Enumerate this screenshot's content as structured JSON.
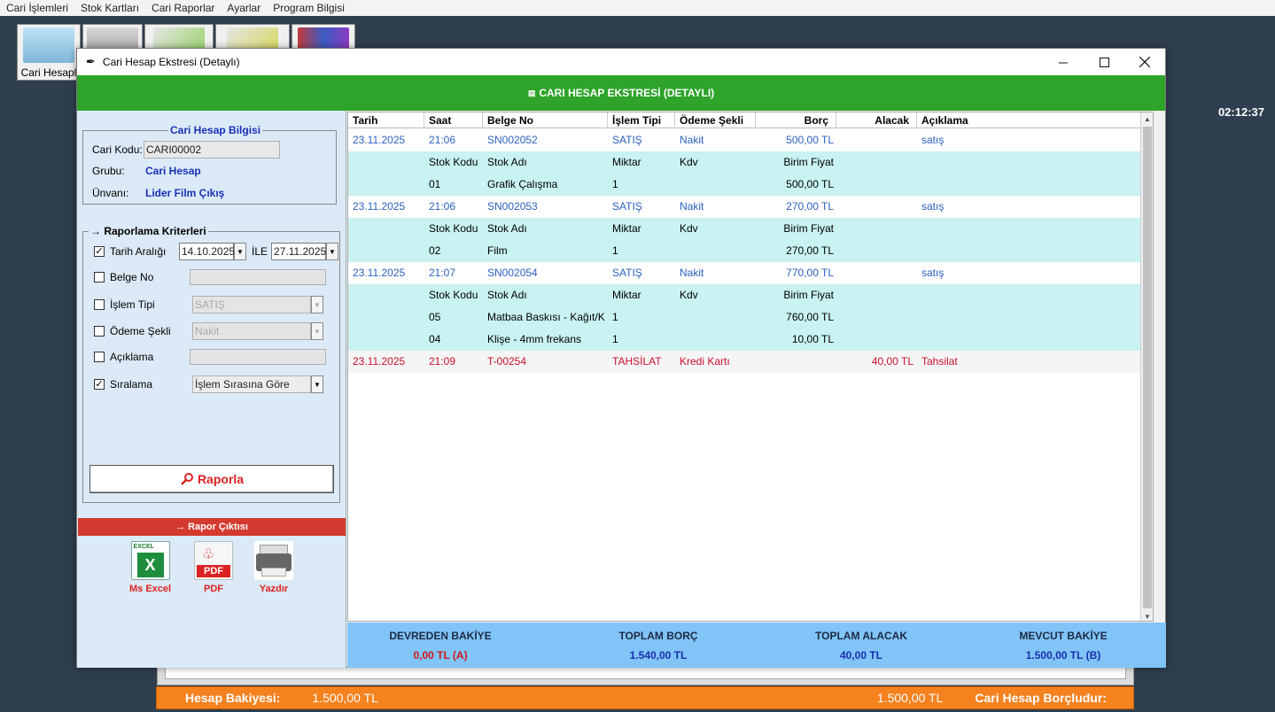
{
  "menubar": [
    "Cari İşlemleri",
    "Stok Kartları",
    "Cari Raporlar",
    "Ayarlar",
    "Program Bilgisi"
  ],
  "toolbar": {
    "first_label": "Cari Hesapl"
  },
  "clock": "02:12:37",
  "status_bar": {
    "label": "Hesap Bakiyesi:",
    "value_left": "1.500,00 TL",
    "value_right": "1.500,00 TL",
    "state": "Cari Hesap Borçludur:"
  },
  "window": {
    "title": "Cari Hesap Ekstresi (Detaylı)",
    "header": "CARI HESAP EKSTRESİ (DETAYLI)"
  },
  "account_info": {
    "title": "Cari Hesap Bilgisi",
    "code_label": "Cari Kodu:",
    "code_value": "CARI00002",
    "group_label": "Grubu:",
    "group_value": "Cari Hesap",
    "name_label": "Ünvanı:",
    "name_value": "Lider Film Çıkış"
  },
  "criteria": {
    "title": "Raporlama Kriterleri",
    "date_range_label": "Tarih Aralığı",
    "date_from": "14.10.2025",
    "date_sep": "İLE",
    "date_to": "27.11.2025",
    "doc_no_label": "Belge No",
    "tx_type_label": "İşlem Tipi",
    "tx_type_value": "SATIŞ",
    "payment_label": "Ödeme Şekli",
    "payment_value": "Nakit",
    "desc_label": "Açıklama",
    "sort_label": "Sıralama",
    "sort_value": "İşlem Sırasına Göre",
    "report_button": "Raporla"
  },
  "output": {
    "title": "Rapor Çıktısı",
    "excel": "Ms Excel",
    "pdf": "PDF",
    "print": "Yazdır",
    "excel_icon_text": "EXCEL",
    "pdf_icon_text": "PDF"
  },
  "grid": {
    "headers": [
      "Tarih",
      "Saat",
      "Belge No",
      "İşlem Tipi",
      "Ödeme Şekli",
      "Borç",
      "Alacak",
      "Açıklama"
    ],
    "rows": [
      {
        "kind": "sale",
        "cells": [
          "23.11.2025",
          "21:06",
          "SN002052",
          "SATIŞ",
          "Nakit",
          "500,00 TL",
          "",
          "satış"
        ]
      },
      {
        "kind": "detail-head",
        "cells": [
          "",
          "Stok Kodu",
          "Stok Adı",
          "Miktar",
          "Kdv",
          "Birim Fiyat",
          "",
          ""
        ]
      },
      {
        "kind": "detail",
        "cells": [
          "",
          "01",
          "Grafik Çalışma",
          "1",
          "",
          "500,00 TL",
          "",
          ""
        ]
      },
      {
        "kind": "sale",
        "cells": [
          "23.11.2025",
          "21:06",
          "SN002053",
          "SATIŞ",
          "Nakit",
          "270,00 TL",
          "",
          "satış"
        ]
      },
      {
        "kind": "detail-head",
        "cells": [
          "",
          "Stok Kodu",
          "Stok Adı",
          "Miktar",
          "Kdv",
          "Birim Fiyat",
          "",
          ""
        ]
      },
      {
        "kind": "detail",
        "cells": [
          "",
          "02",
          "Film",
          "1",
          "",
          "270,00 TL",
          "",
          ""
        ]
      },
      {
        "kind": "sale",
        "cells": [
          "23.11.2025",
          "21:07",
          "SN002054",
          "SATIŞ",
          "Nakit",
          "770,00 TL",
          "",
          "satış"
        ]
      },
      {
        "kind": "detail-head",
        "cells": [
          "",
          "Stok Kodu",
          "Stok Adı",
          "Miktar",
          "Kdv",
          "Birim Fiyat",
          "",
          ""
        ]
      },
      {
        "kind": "detail",
        "cells": [
          "",
          "05",
          "Matbaa Baskısı - Kağıt/K",
          "1",
          "",
          "760,00 TL",
          "",
          ""
        ]
      },
      {
        "kind": "detail",
        "cells": [
          "",
          "04",
          "Klişe - 4mm frekans",
          "1",
          "",
          "10,00 TL",
          "",
          ""
        ]
      },
      {
        "kind": "collection",
        "cells": [
          "23.11.2025",
          "21:09",
          "T-00254",
          "TAHSİLAT",
          "Kredi Kartı",
          "",
          "40,00 TL",
          "Tahsilat"
        ]
      }
    ]
  },
  "summary": {
    "carry_label": "DEVREDEN BAKİYE",
    "carry_value": "0,00 TL (A)",
    "debit_label": "TOPLAM BORÇ",
    "debit_value": "1.540,00 TL",
    "credit_label": "TOPLAM ALACAK",
    "credit_value": "40,00 TL",
    "balance_label": "MEVCUT BAKİYE",
    "balance_value": "1.500,00 TL (B)"
  },
  "colors": {
    "header_green": "#2ea42a",
    "sale_blue": "#2a5fbf",
    "collection_red": "#c8102e",
    "detail_bg": "#c9f2f2",
    "summary_bg": "#80c4f8",
    "status_orange": "#f5821f"
  }
}
